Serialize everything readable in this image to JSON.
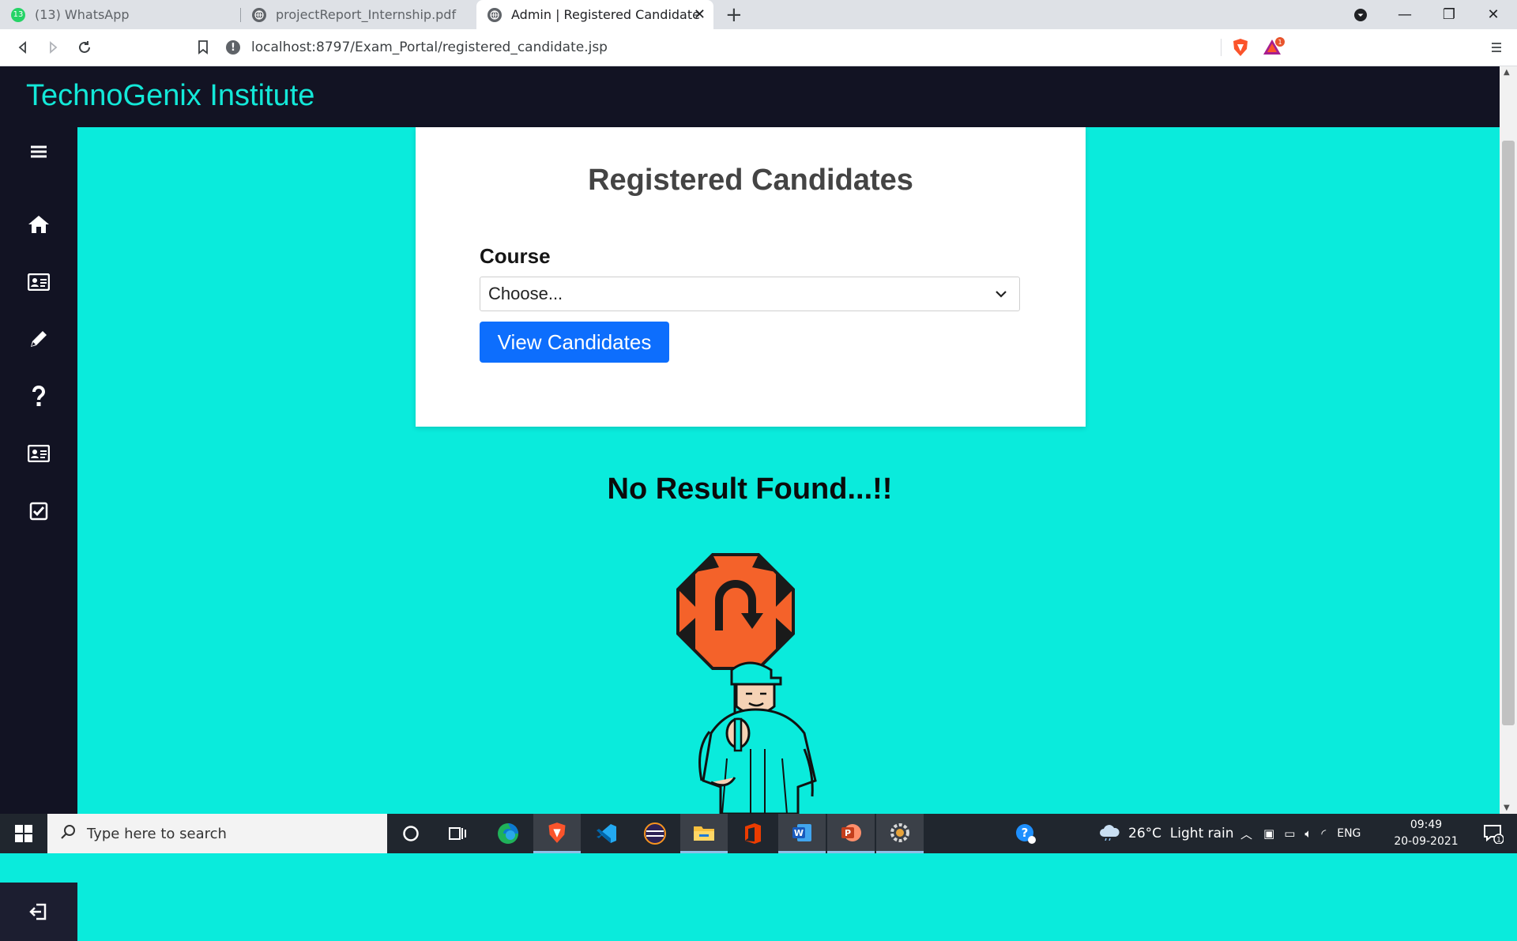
{
  "browser": {
    "tabs": [
      {
        "title": "(13) WhatsApp",
        "badge": "13"
      },
      {
        "title": "projectReport_Internship.pdf"
      },
      {
        "title": "Admin | Registered Candidate",
        "active": true
      }
    ],
    "url": "localhost:8797/Exam_Portal/registered_candidate.jsp",
    "extension_badge": "1"
  },
  "page": {
    "brand": "TechnoGenix Institute",
    "sidebar_icons": [
      "menu-icon",
      "home-icon",
      "id-card-icon",
      "pencil-icon",
      "question-icon",
      "profile-card-icon",
      "checkbox-icon",
      "logout-icon"
    ],
    "card_title": "Registered Candidates",
    "course_label": "Course",
    "course_select_value": "Choose...",
    "view_button": "View Candidates",
    "no_result": "No Result Found...!!",
    "colors": {
      "page_bg": "#0aebdc",
      "nav_bg": "#121323",
      "brand_color": "#13e8d8",
      "button_blue": "#0d6efd",
      "sign_orange": "#f4622a"
    }
  },
  "taskbar": {
    "search_placeholder": "Type here to search",
    "weather": "26°C  Light rain",
    "lang": "ENG",
    "time": "09:49",
    "date": "20-09-2021",
    "notification_count": "1"
  }
}
